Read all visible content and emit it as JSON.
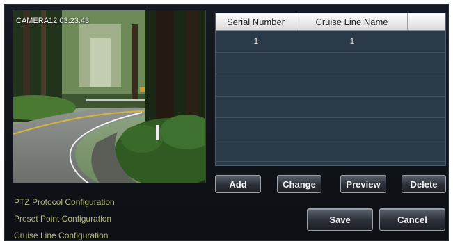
{
  "camera": {
    "label": "CAMERA12 03:23:43"
  },
  "table": {
    "headers": [
      "Serial Number",
      "Cruise Line Name",
      ""
    ],
    "rows": [
      [
        "1",
        "1",
        ""
      ],
      [
        "",
        "",
        ""
      ],
      [
        "",
        "",
        ""
      ],
      [
        "",
        "",
        ""
      ],
      [
        "",
        "",
        ""
      ],
      [
        "",
        "",
        ""
      ]
    ]
  },
  "actions": {
    "add": "Add",
    "change": "Change",
    "preview": "Preview",
    "delete": "Delete"
  },
  "footer": {
    "save": "Save",
    "cancel": "Cancel"
  },
  "nav": {
    "items": [
      "PTZ Protocol Configuration",
      "Preset Point Configuration",
      "Cruise Line Configuration"
    ]
  },
  "colors": {
    "panel_bg": "#10141a",
    "grid_bg": "#2b3a48",
    "nav_text": "#b4b97a"
  }
}
